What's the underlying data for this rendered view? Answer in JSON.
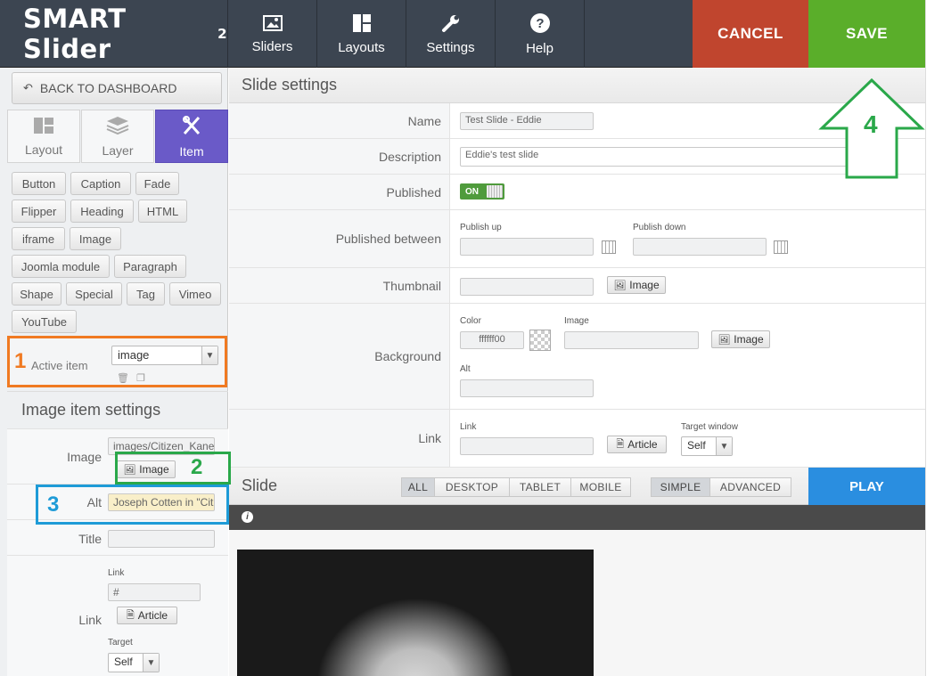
{
  "app": {
    "logo_text": "SMART Slider",
    "logo_sup": "2"
  },
  "topnav": {
    "tabs": [
      {
        "label": "Sliders",
        "icon": "image-icon"
      },
      {
        "label": "Layouts",
        "icon": "layouts-icon"
      },
      {
        "label": "Settings",
        "icon": "wrench-icon"
      },
      {
        "label": "Help",
        "icon": "help-icon"
      }
    ],
    "cancel_label": "CANCEL",
    "save_label": "SAVE"
  },
  "sidebar": {
    "back_label": "BACK TO DASHBOARD",
    "panel_tabs": [
      {
        "label": "Layout",
        "icon": "layout-grid-icon"
      },
      {
        "label": "Layer",
        "icon": "layers-icon"
      },
      {
        "label": "Item",
        "icon": "item-icon"
      }
    ],
    "items": [
      "Button",
      "Caption",
      "Fade",
      "Flipper",
      "Heading",
      "HTML",
      "iframe",
      "Image",
      "Joomla module",
      "Paragraph",
      "Shape",
      "Special",
      "Tag",
      "Vimeo",
      "YouTube"
    ],
    "active_item_label": "Active item",
    "active_item_value": "image",
    "image_settings_title": "Image item settings",
    "image_label": "Image",
    "image_value": "images/Citizen_Kane-",
    "image_button": "Image",
    "alt_label": "Alt",
    "alt_value": "Joseph Cotten in \"Citi",
    "title_label": "Title",
    "title_value": "",
    "link_label": "Link",
    "link_sublabel": "Link",
    "link_value": "#",
    "article_button": "Article",
    "target_label": "Target",
    "target_value": "Self"
  },
  "main": {
    "title": "Slide settings",
    "name_label": "Name",
    "name_value": "Test Slide - Eddie",
    "description_label": "Description",
    "description_value": "Eddie's test slide",
    "published_label": "Published",
    "published_toggle": "ON",
    "published_between_label": "Published between",
    "publish_up_label": "Publish up",
    "publish_down_label": "Publish down",
    "thumbnail_label": "Thumbnail",
    "thumbnail_button": "Image",
    "background_label": "Background",
    "color_label": "Color",
    "color_value": "ffffff00",
    "bg_image_label": "Image",
    "bg_image_button": "Image",
    "alt_label": "Alt",
    "link_row_label": "Link",
    "link_sublabel": "Link",
    "article_button": "Article",
    "target_window_label": "Target window",
    "target_window_value": "Self"
  },
  "slide": {
    "title": "Slide",
    "devices": [
      "ALL",
      "DESKTOP",
      "TABLET",
      "MOBILE"
    ],
    "modes": [
      "SIMPLE",
      "ADVANCED"
    ],
    "play_label": "PLAY"
  },
  "annotations": {
    "n1": "1",
    "n2": "2",
    "n3": "3",
    "n4": "4",
    "colors": {
      "orange": "#f07a22",
      "green": "#2aa84a",
      "blue": "#1e9bd7"
    }
  }
}
